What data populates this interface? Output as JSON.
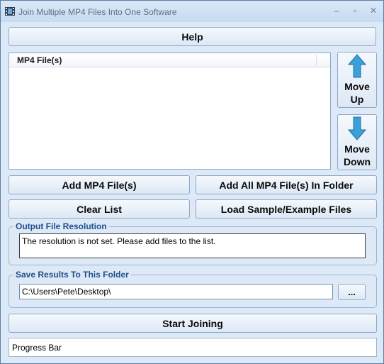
{
  "window": {
    "title": "Join Multiple MP4 Files Into One Software",
    "minimize_glyph": "–",
    "maximize_glyph": "▫",
    "close_glyph": "✕"
  },
  "toolbar": {
    "help_label": "Help"
  },
  "file_list": {
    "column_header": "MP4 File(s)",
    "items": []
  },
  "move_buttons": {
    "up_line1": "Move",
    "up_line2": "Up",
    "down_line1": "Move",
    "down_line2": "Down"
  },
  "actions": {
    "add_files": "Add MP4 File(s)",
    "add_folder": "Add All MP4 File(s) In Folder",
    "clear_list": "Clear List",
    "load_sample": "Load Sample/Example Files"
  },
  "resolution": {
    "group_label": "Output File Resolution",
    "message": "The resolution is not set. Please add files to the list."
  },
  "output_folder": {
    "group_label": "Save Results To This Folder",
    "path": "C:\\Users\\Pete\\Desktop\\",
    "browse_label": "..."
  },
  "start_button": {
    "label": "Start Joining"
  },
  "progress": {
    "label": "Progress Bar",
    "value": 0
  },
  "colors": {
    "accent": "#1f4f8a",
    "window_bg": "#dde9f7",
    "arrow": "#3aa0d8"
  },
  "icons": {
    "app": "film-icon",
    "up": "arrow-up-icon",
    "down": "arrow-down-icon"
  }
}
